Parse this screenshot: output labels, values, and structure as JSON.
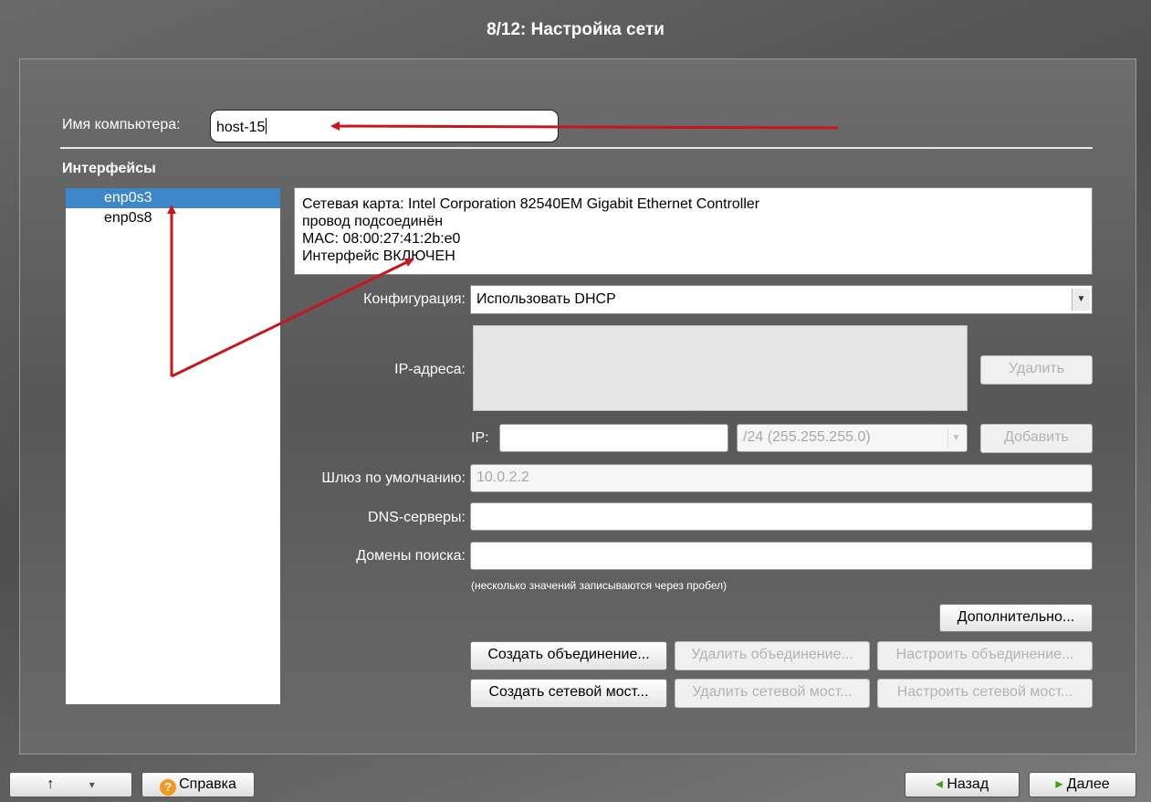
{
  "title": "8/12: Настройка сети",
  "hostname": {
    "label": "Имя компьютера:",
    "value": "host-15"
  },
  "interfaces": {
    "heading": "Интерфейсы",
    "items": [
      {
        "label": "enp0s3",
        "selected": true
      },
      {
        "label": "enp0s8",
        "selected": false
      }
    ]
  },
  "info": {
    "lines": [
      "Сетевая карта: Intel Corporation 82540EM Gigabit Ethernet Controller",
      "провод подсоединён",
      "MAC: 08:00:27:41:2b:e0",
      "Интерфейс ВКЛЮЧЕН"
    ]
  },
  "config": {
    "label": "Конфигурация:",
    "value": "Использовать DHCP"
  },
  "ip_addresses": {
    "label": "IP-адреса:",
    "delete_label": "Удалить"
  },
  "ip": {
    "label": "IP:",
    "value": "",
    "mask": "/24 (255.255.255.0)",
    "add_label": "Добавить"
  },
  "gateway": {
    "label": "Шлюз по умолчанию:",
    "value": "10.0.2.2"
  },
  "dns": {
    "label": "DNS-серверы:",
    "value": ""
  },
  "search_domains": {
    "label": "Домены поиска:",
    "value": ""
  },
  "hint": "(несколько значений записываются через пробел)",
  "buttons": {
    "advanced": "Дополнительно...",
    "create_bond": "Создать объединение...",
    "delete_bond": "Удалить объединение...",
    "configure_bond": "Настроить объединение...",
    "create_bridge": "Создать сетевой мост...",
    "delete_bridge": "Удалить сетевой мост...",
    "configure_bridge": "Настроить сетевой мост..."
  },
  "footer": {
    "up_glyph": "↑",
    "dropdown_glyph": "▾",
    "help_icon_glyph": "?",
    "help_label": "Справка",
    "back_glyph": "◂",
    "back_label": "Назад",
    "next_glyph": "▸",
    "next_label": "Далее"
  },
  "colors": {
    "selection": "#3d86c8",
    "annotation_arrow": "#c8161c",
    "help_icon": "#f39a1e",
    "nav_arrow": "#3aa11a"
  }
}
